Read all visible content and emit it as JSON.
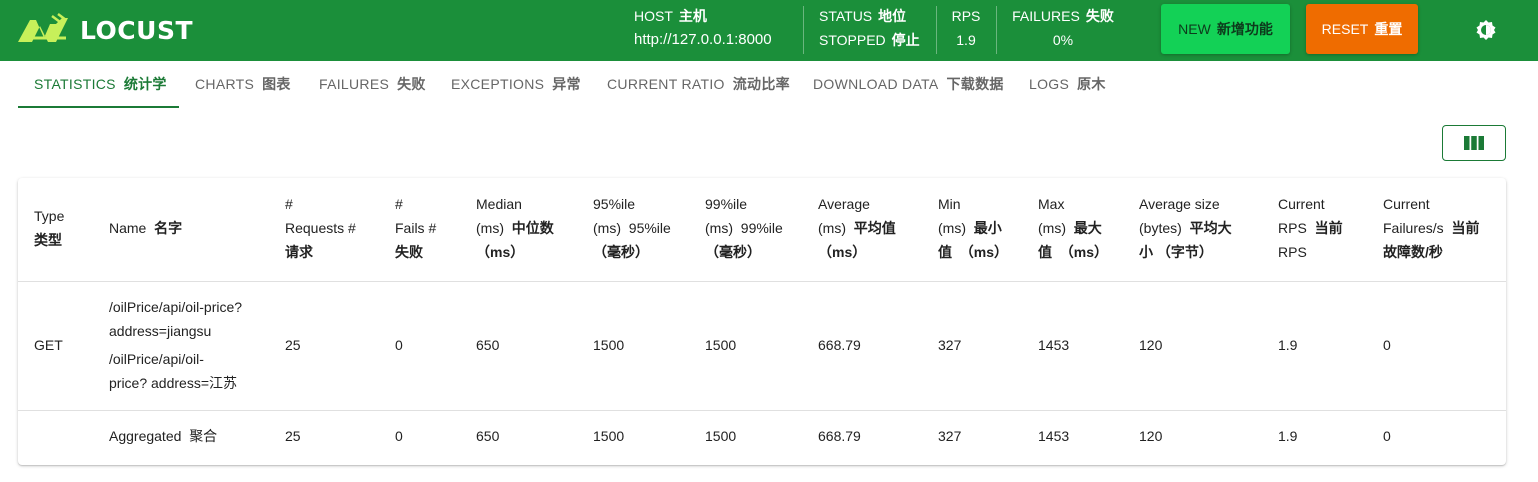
{
  "app": {
    "logo_text": "LOCUST"
  },
  "header": {
    "host": {
      "label": "HOST",
      "label_zh": "主机",
      "value": "http://127.0.0.1:8000"
    },
    "status": {
      "label": "STATUS",
      "label_zh": "地位",
      "value": "STOPPED",
      "value_zh": "停止"
    },
    "rps": {
      "label": "RPS",
      "value": "1.9"
    },
    "failures": {
      "label": "FAILURES",
      "label_zh": "失败",
      "value": "0%"
    },
    "new_button": {
      "label": "NEW",
      "label_zh": "新增功能"
    },
    "reset_button": {
      "label": "RESET",
      "label_zh": "重置"
    },
    "theme_icon": "brightness-icon"
  },
  "tabs": [
    {
      "label": "STATISTICS",
      "label_zh": "统计学",
      "active": true
    },
    {
      "label": "CHARTS",
      "label_zh": "图表"
    },
    {
      "label": "FAILURES",
      "label_zh": "失败"
    },
    {
      "label": "EXCEPTIONS",
      "label_zh": "异常"
    },
    {
      "label": "CURRENT RATIO",
      "label_zh": "流动比率"
    },
    {
      "label": "DOWNLOAD DATA",
      "label_zh": "下载数据"
    },
    {
      "label": "LOGS",
      "label_zh": "原木"
    }
  ],
  "toolbar": {
    "columns_icon": "view-columns-icon"
  },
  "table": {
    "headers": {
      "type": {
        "en": "Type",
        "zh": "类型"
      },
      "name": {
        "en": "Name",
        "zh": "名字"
      },
      "requests": {
        "en1": "#",
        "en2": "Requests #",
        "zh": "请求"
      },
      "fails": {
        "en1": "#",
        "en2": "Fails #",
        "zh": "失败"
      },
      "median": {
        "en1": "Median",
        "en2": "(ms)",
        "zh2": "中位数",
        "zh3": "（ms）"
      },
      "p95": {
        "en1": "95%ile",
        "en2": "(ms)",
        "zh2": "95%ile",
        "zh3": "（毫秒）"
      },
      "p99": {
        "en1": "99%ile",
        "en2": "(ms)",
        "zh2": "99%ile",
        "zh3": "（毫秒）"
      },
      "average": {
        "en1": "Average",
        "en2": "(ms)",
        "zh2": "平均值",
        "zh3": "（ms）"
      },
      "min": {
        "en1": "Min",
        "en2": "(ms)",
        "zh2": "最小",
        "zh3a": "值",
        "zh3b": "（ms）"
      },
      "max": {
        "en1": "Max",
        "en2": "(ms)",
        "zh2": "最大",
        "zh3a": "值",
        "zh3b": "（ms）"
      },
      "avg_size": {
        "en1": "Average size",
        "en2": "(bytes)",
        "zh2": "平均大",
        "zh3": "小 （字节）"
      },
      "current_rps": {
        "en1": "Current",
        "en2": "RPS",
        "zh2": "当前",
        "en3": "RPS"
      },
      "current_failures": {
        "en1": "Current",
        "en2": "Failures/s",
        "zh2": "当前",
        "zh3": "故障数/秒"
      }
    },
    "rows": [
      {
        "type": "GET",
        "name_line1": "/oilPrice/api/oil-price?",
        "name_line2": "address=jiangsu",
        "name_line3": "/oilPrice/api/oil-",
        "name_line4": "price?  address=江苏",
        "requests": "25",
        "fails": "0",
        "median": "650",
        "p95": "1500",
        "p99": "1500",
        "average": "668.79",
        "min": "327",
        "max": "1453",
        "avg_size": "120",
        "current_rps": "1.9",
        "current_failures": "0"
      },
      {
        "type": "",
        "name_en": "Aggregated",
        "name_zh": "聚合",
        "requests": "25",
        "fails": "0",
        "median": "650",
        "p95": "1500",
        "p99": "1500",
        "average": "668.79",
        "min": "327",
        "max": "1453",
        "avg_size": "120",
        "current_rps": "1.9",
        "current_failures": "0"
      }
    ]
  },
  "colors": {
    "header_bg": "#1b8f3a",
    "accent": "#1b7a36",
    "new_button": "#13d156",
    "reset_button": "#ef6c00"
  }
}
